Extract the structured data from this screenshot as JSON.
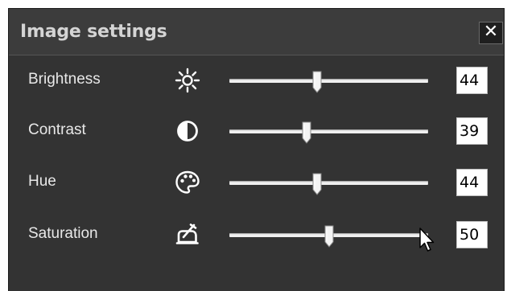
{
  "window": {
    "title": "Image settings",
    "close_symbol": "✕",
    "background": "#333333",
    "titlebar_background": "#3c3c3c"
  },
  "settings": [
    {
      "label": "Brightness",
      "icon": "sun-icon",
      "value": "44",
      "slider_fraction": 0.44
    },
    {
      "label": "Contrast",
      "icon": "contrast-icon",
      "value": "39",
      "slider_fraction": 0.39
    },
    {
      "label": "Hue",
      "icon": "palette-icon",
      "value": "44",
      "slider_fraction": 0.44
    },
    {
      "label": "Saturation",
      "icon": "saturation-icon",
      "value": "50",
      "slider_fraction": 0.5
    }
  ],
  "colors": {
    "label_text": "#e8e8e8",
    "track": "#f0f0f0",
    "value_box": "#ffffff"
  },
  "cursor_icon": "arrow-cursor-icon"
}
